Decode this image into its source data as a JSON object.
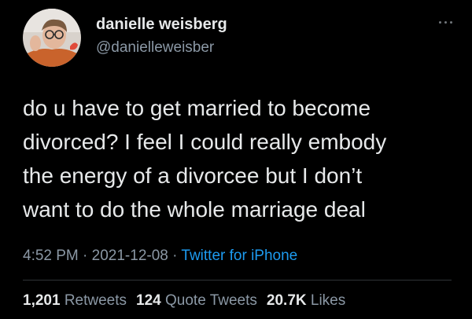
{
  "author": {
    "display_name": "danielle weisberg",
    "handle": "@danielleweisber"
  },
  "tweet": {
    "text_lines": [
      "do u have to get married to become",
      "divorced? I feel I could really embody",
      "the energy of a divorcee but I don’t",
      "want to do the whole marriage deal"
    ],
    "time": "4:52 PM",
    "date": "2021-12-08",
    "separator": " · ",
    "source": "Twitter for iPhone"
  },
  "stats": {
    "retweets": {
      "count": "1,201",
      "label": "Retweets"
    },
    "quotes": {
      "count": "124",
      "label": "Quote Tweets"
    },
    "likes": {
      "count": "20.7K",
      "label": "Likes"
    }
  },
  "icons": {
    "more": "more-horizontal-icon"
  },
  "colors": {
    "background": "#000000",
    "primary_text": "#e7e9ea",
    "secondary_text": "#8b98a5",
    "link": "#1d9bf0",
    "divider": "#2f3336"
  }
}
